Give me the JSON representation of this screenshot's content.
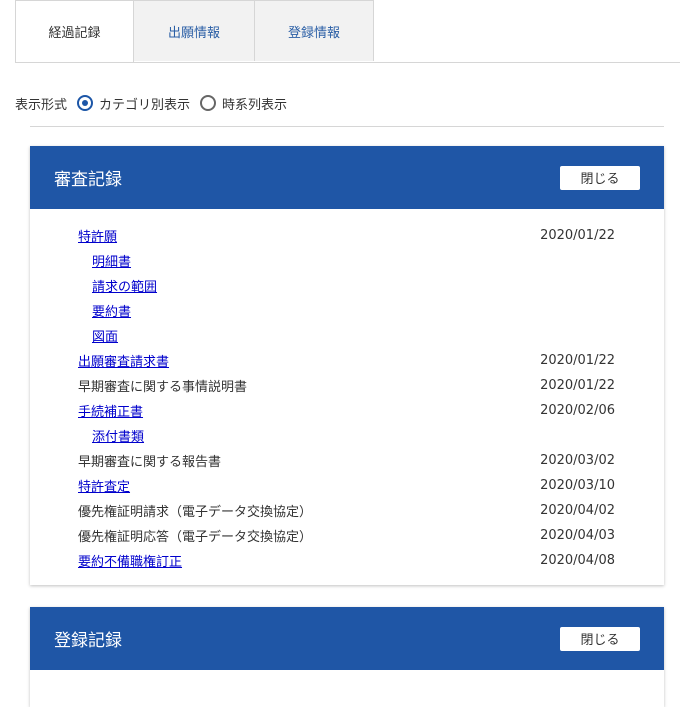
{
  "tabs": [
    {
      "label": "経過記録"
    },
    {
      "label": "出願情報"
    },
    {
      "label": "登録情報"
    }
  ],
  "display_mode": {
    "label": "表示形式",
    "options": [
      {
        "label": "カテゴリ別表示",
        "selected": true
      },
      {
        "label": "時系列表示",
        "selected": false
      }
    ]
  },
  "exam_record": {
    "title": "審査記録",
    "close_label": "閉じる",
    "rows": [
      {
        "name": "特許願",
        "date": "2020/01/22",
        "link": true,
        "indent": false
      },
      {
        "name": "明細書",
        "date": "",
        "link": true,
        "indent": true
      },
      {
        "name": "請求の範囲",
        "date": "",
        "link": true,
        "indent": true
      },
      {
        "name": "要約書",
        "date": "",
        "link": true,
        "indent": true
      },
      {
        "name": "図面",
        "date": "",
        "link": true,
        "indent": true
      },
      {
        "name": "出願審査請求書",
        "date": "2020/01/22",
        "link": true,
        "indent": false
      },
      {
        "name": "早期審査に関する事情説明書",
        "date": "2020/01/22",
        "link": false,
        "indent": false
      },
      {
        "name": "手続補正書",
        "date": "2020/02/06",
        "link": true,
        "indent": false
      },
      {
        "name": "添付書類",
        "date": "",
        "link": true,
        "indent": true
      },
      {
        "name": "早期審査に関する報告書",
        "date": "2020/03/02",
        "link": false,
        "indent": false
      },
      {
        "name": "特許査定",
        "date": "2020/03/10",
        "link": true,
        "indent": false
      },
      {
        "name": "優先権証明請求（電子データ交換協定）",
        "date": "2020/04/02",
        "link": false,
        "indent": false
      },
      {
        "name": "優先権証明応答（電子データ交換協定）",
        "date": "2020/04/03",
        "link": false,
        "indent": false
      },
      {
        "name": "要約不備職権訂正",
        "date": "2020/04/08",
        "link": true,
        "indent": false
      }
    ]
  },
  "registration_record": {
    "title": "登録記録",
    "close_label": "閉じる"
  },
  "colors": {
    "header_blue": "#1f56a6",
    "link_blue": "#0000cc",
    "radio_blue": "#1c56a7"
  }
}
